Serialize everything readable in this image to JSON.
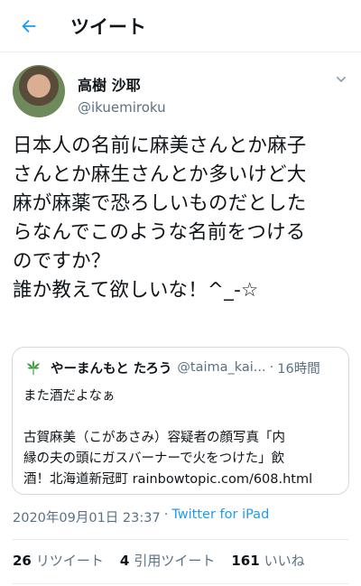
{
  "header": {
    "title": "ツイート",
    "back_icon": "arrow-left-icon",
    "accent": "#1d9bf0"
  },
  "author": {
    "display_name": "高樹 沙耶",
    "handle": "@ikuemiroku"
  },
  "tweet": {
    "text": "日本人の名前に麻美さんとか麻子\nさんとか麻生さんとか多いけど大\n麻が麻薬で恐ろしいものだとした\nらなんでこのような名前をつける\nのですか？\n誰か教えて欲しいな！^_-☆"
  },
  "quote": {
    "name": "やーまんもと たろう",
    "handle": "@taima_kai...",
    "dot": "·",
    "time": "16時間",
    "text": "また酒だよなぁ\n\n古賀麻美（こがあさみ）容疑者の顔写真「内\n縁の夫の頭にガスバーナーで火をつけた」飲\n酒！北海道新冠町 rainbowtopic.com/608.html"
  },
  "meta": {
    "datetime": "2020年09月01日 23:37",
    "dot": "·",
    "source": "Twitter for iPad"
  },
  "stats": {
    "retweets": "26",
    "retweets_label": "リツイート",
    "quotes": "4",
    "quotes_label": "引用ツイート",
    "likes": "161",
    "likes_label": "いいね"
  }
}
